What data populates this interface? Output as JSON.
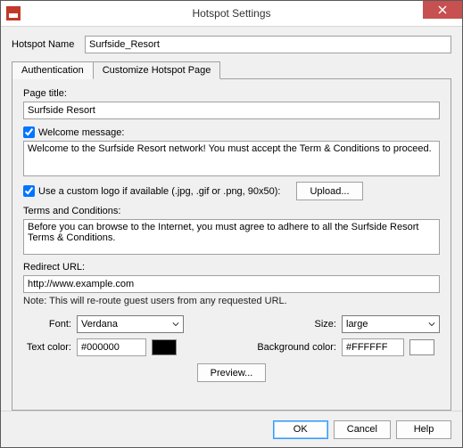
{
  "window": {
    "title": "Hotspot Settings"
  },
  "hotspotName": {
    "label": "Hotspot Name",
    "value": "Surfside_Resort"
  },
  "tabs": {
    "auth": "Authentication",
    "customize": "Customize Hotspot Page"
  },
  "page": {
    "titleLabel": "Page title:",
    "titleValue": "Surfside Resort",
    "welcomeCheck": "Welcome message:",
    "welcomeValue": "Welcome to the Surfside Resort network! You must accept the Term & Conditions to proceed.",
    "logoCheck": "Use a custom logo if available (.jpg, .gif or .png, 90x50):",
    "uploadBtn": "Upload...",
    "tcLabel": "Terms and Conditions:",
    "tcValue": "Before you can browse to the Internet, you must agree to adhere to all the Surfside Resort Terms & Conditions.",
    "redirectLabel": "Redirect URL:",
    "redirectValue": "http://www.example.com",
    "redirectNote": "Note: This will re-route guest users from any requested URL.",
    "fontLabel": "Font:",
    "fontValue": "Verdana",
    "sizeLabel": "Size:",
    "sizeValue": "large",
    "textColorLabel": "Text color:",
    "textColorValue": "#000000",
    "bgColorLabel": "Background color:",
    "bgColorValue": "#FFFFFF",
    "previewBtn": "Preview..."
  },
  "footer": {
    "ok": "OK",
    "cancel": "Cancel",
    "help": "Help"
  },
  "colors": {
    "textSwatch": "#000000",
    "bgSwatch": "#FFFFFF"
  }
}
